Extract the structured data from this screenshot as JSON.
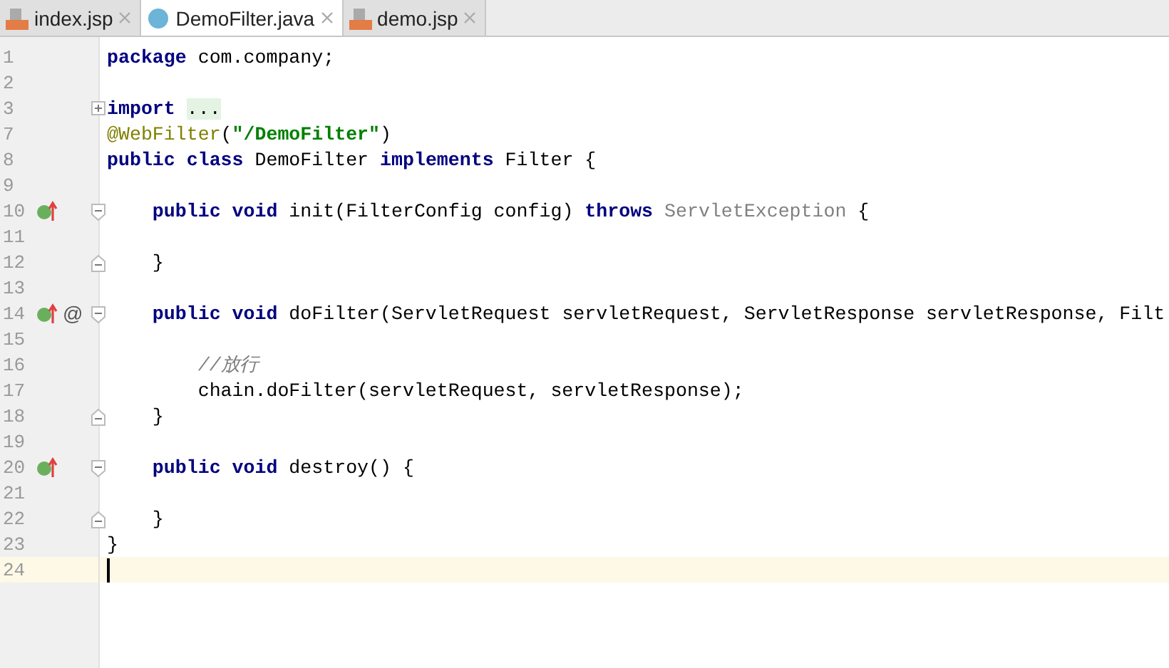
{
  "tabs": [
    {
      "label": "index.jsp",
      "kind": "jsp",
      "selected": false
    },
    {
      "label": "DemoFilter.java",
      "kind": "class",
      "selected": true
    },
    {
      "label": "demo.jsp",
      "kind": "jsp",
      "selected": false
    }
  ],
  "editor": {
    "lines": [
      {
        "number": "1",
        "current": false,
        "code": [
          {
            "kind": "keyword",
            "text": "package"
          },
          {
            "kind": "plain",
            "text": " com.company;"
          }
        ]
      },
      {
        "number": "2",
        "current": false
      },
      {
        "number": "3",
        "current": false,
        "collapsed": true,
        "code": [
          {
            "kind": "keyword",
            "text": "import"
          },
          {
            "kind": "folded",
            "text": "..."
          }
        ]
      },
      {
        "number": "7",
        "current": false,
        "code": [
          {
            "kind": "annotation",
            "text": "@WebFilter"
          },
          {
            "kind": "plain",
            "text": "("
          },
          {
            "kind": "string",
            "text": "\"/DemoFilter\""
          },
          {
            "kind": "plain",
            "text": ")"
          }
        ]
      },
      {
        "number": "8",
        "current": false,
        "code": [
          {
            "kind": "keyword",
            "text": "public class"
          },
          {
            "kind": "plain",
            "text": " DemoFilter "
          },
          {
            "kind": "keyword",
            "text": "implements"
          },
          {
            "kind": "plain",
            "text": " Filter {"
          }
        ]
      },
      {
        "number": "9",
        "current": false
      },
      {
        "number": "10",
        "current": false,
        "overrides": true,
        "fold_start": true,
        "code": [
          {
            "kind": "keyword",
            "text": "    public void"
          },
          {
            "kind": "plain",
            "text": " init(FilterConfig config) "
          },
          {
            "kind": "keyword",
            "text": "throws"
          },
          {
            "kind": "muted",
            "text": " ServletException"
          },
          {
            "kind": "plain",
            "text": " {"
          }
        ]
      },
      {
        "number": "11",
        "current": false
      },
      {
        "number": "12",
        "current": false,
        "fold_end": true,
        "code": [
          {
            "kind": "plain",
            "text": "    }"
          }
        ]
      },
      {
        "number": "13",
        "current": false
      },
      {
        "number": "14",
        "current": false,
        "overrides": true,
        "at_mark": "@",
        "fold_start": true,
        "code": [
          {
            "kind": "keyword",
            "text": "    public void"
          },
          {
            "kind": "plain",
            "text": " doFilter(ServletRequest servletRequest, ServletResponse servletResponse, Filt"
          }
        ]
      },
      {
        "number": "15",
        "current": false
      },
      {
        "number": "16",
        "current": false,
        "code": [
          {
            "kind": "comment",
            "text": "        //放行"
          }
        ]
      },
      {
        "number": "17",
        "current": false,
        "code": [
          {
            "kind": "plain",
            "text": "        chain.doFilter(servletRequest, servletResponse);"
          }
        ]
      },
      {
        "number": "18",
        "current": false,
        "fold_end": true,
        "code": [
          {
            "kind": "plain",
            "text": "    }"
          }
        ]
      },
      {
        "number": "19",
        "current": false
      },
      {
        "number": "20",
        "current": false,
        "overrides": true,
        "fold_start": true,
        "code": [
          {
            "kind": "keyword",
            "text": "    public void"
          },
          {
            "kind": "plain",
            "text": " destroy() {"
          }
        ]
      },
      {
        "number": "21",
        "current": false
      },
      {
        "number": "22",
        "current": false,
        "fold_end": true,
        "code": [
          {
            "kind": "plain",
            "text": "    }"
          }
        ]
      },
      {
        "number": "23",
        "current": false,
        "code": [
          {
            "kind": "plain",
            "text": "}"
          }
        ]
      },
      {
        "number": "24",
        "current": true
      }
    ]
  }
}
